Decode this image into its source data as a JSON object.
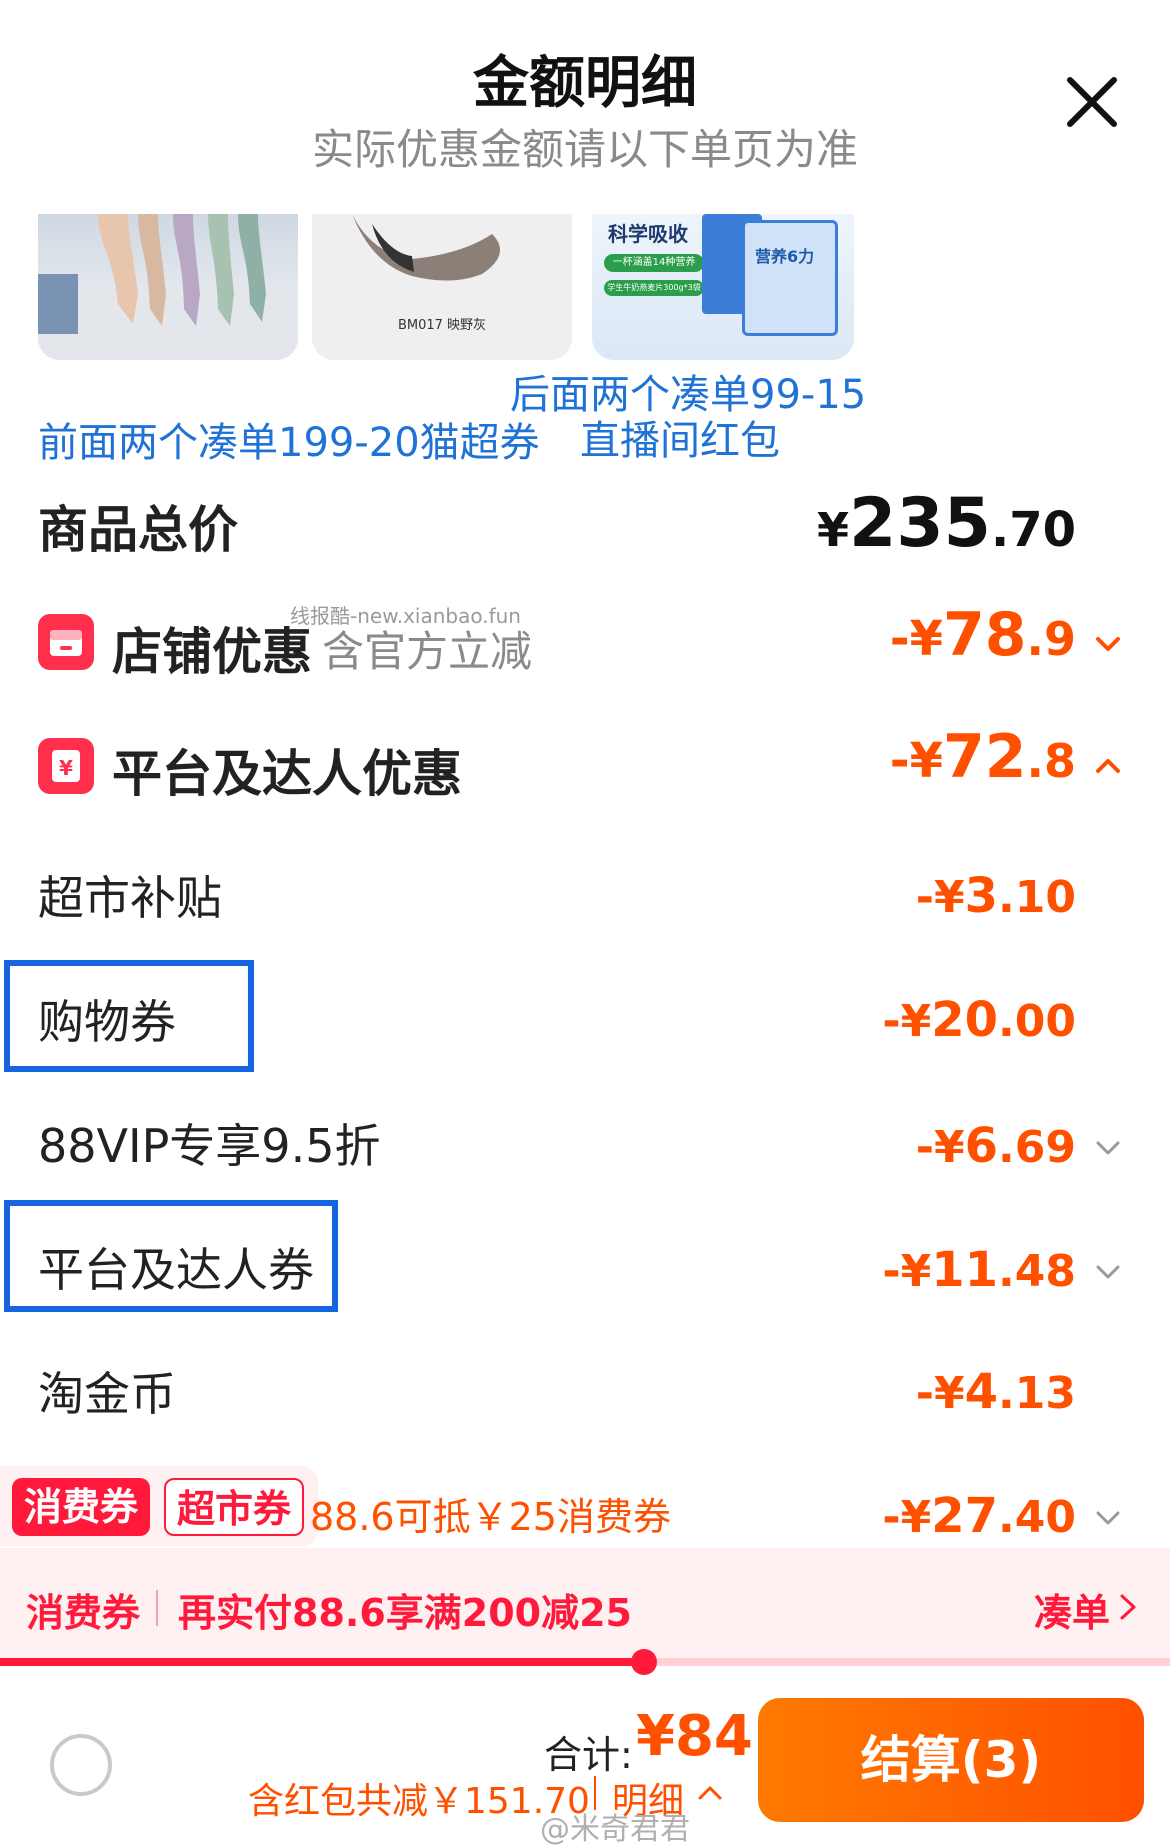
{
  "header": {
    "title": "金额明细",
    "subtitle": "实际优惠金额请以下单页为准"
  },
  "products": {
    "p2_caption": "BM017 映野灰",
    "p3_caption1": "科学吸收",
    "p3_caption2": "一杯涵盖14种营养",
    "p3_caption3": "学生牛奶燕麦片300g*3袋",
    "p3_pack": "营养6力"
  },
  "annotations": {
    "right_line1": "后面两个凑单99-15",
    "right_line2": "直播间红包",
    "left_line": "前面两个凑单199-20猫超券"
  },
  "total": {
    "label": "商品总价",
    "currency": "¥",
    "integer": "235",
    "decimal": ".70"
  },
  "watermark_top": "线报酷-new.xianbao.fun",
  "shop_discount": {
    "label": "店铺优惠",
    "note": "含官方立减",
    "sign": "-¥",
    "integer": "78",
    "decimal": ".9"
  },
  "platform_discount": {
    "label": "平台及达人优惠",
    "sign": "-¥",
    "integer": "72",
    "decimal": ".8",
    "icon_text": "¥"
  },
  "items": [
    {
      "label": "超市补贴",
      "sign": "-¥",
      "integer": "3",
      "decimal": ".10"
    },
    {
      "label": "购物券",
      "sign": "-¥",
      "integer": "20",
      "decimal": ".00"
    },
    {
      "label": "88VIP专享9.5折",
      "sign": "-¥",
      "integer": "6",
      "decimal": ".69"
    },
    {
      "label": "平台及达人券",
      "sign": "-¥",
      "integer": "11",
      "decimal": ".48"
    },
    {
      "label": "淘金币",
      "sign": "-¥",
      "integer": "4",
      "decimal": ".13"
    }
  ],
  "coupon_row": {
    "tag1": "消费券",
    "tag2": "超市券",
    "text": "88.6可抵￥25消费券",
    "sign": "-¥",
    "integer": "27",
    "decimal": ".40"
  },
  "coupon_bar": {
    "tag": "消费券",
    "text": "再实付88.6享满200减25",
    "action": "凑单",
    "progress": 0.55
  },
  "bottom": {
    "total_label": "合计:",
    "total_value": "¥84",
    "saving_text": "含红包共减￥151.70",
    "detail_link": "明细",
    "checkout": "结算(3)",
    "watermark": "@米奇君君"
  }
}
